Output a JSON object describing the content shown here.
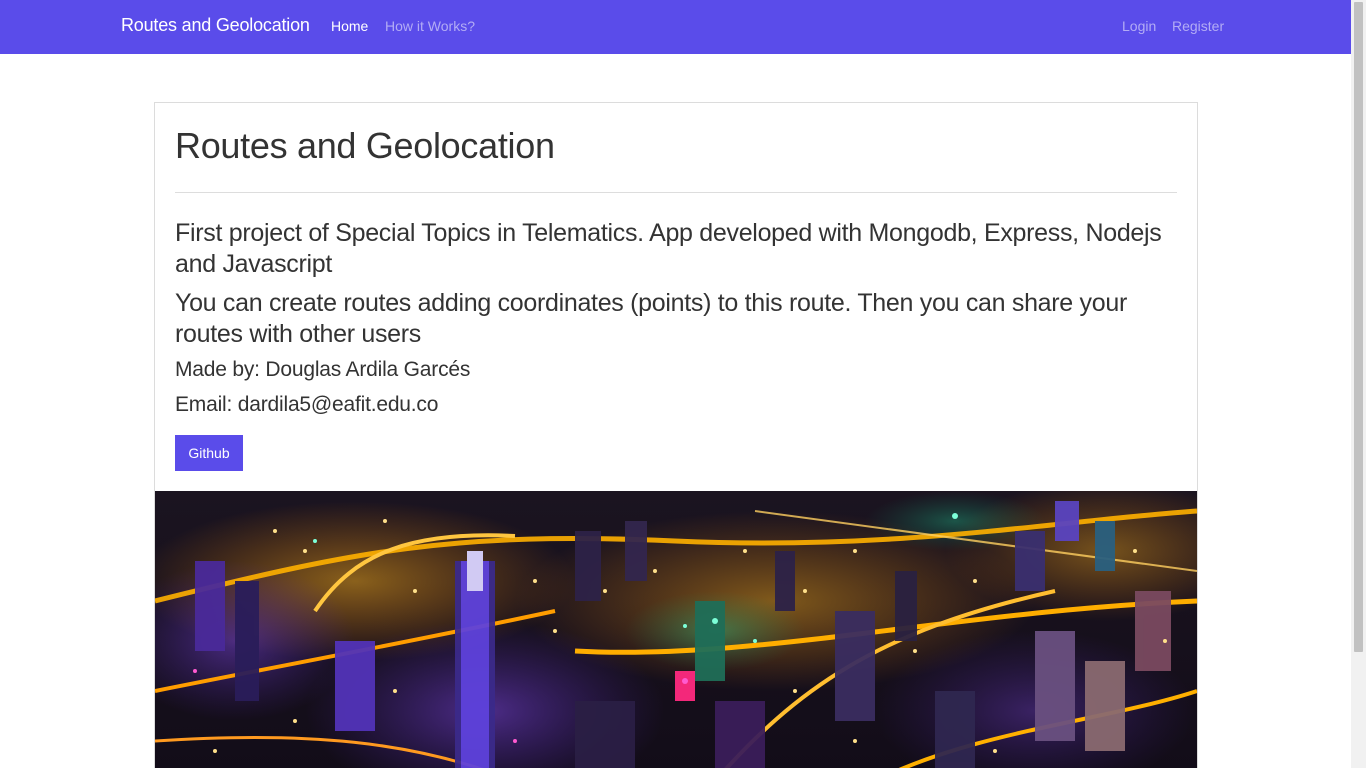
{
  "navbar": {
    "brand": "Routes and Geolocation",
    "links": [
      "Home",
      "How it Works?"
    ],
    "right_links": [
      "Login",
      "Register"
    ],
    "accent_color": "#5a4cea"
  },
  "main": {
    "title": "Routes and Geolocation",
    "description": "First project of Special Topics in Telematics. App developed with Mongodb, Express, Nodejs and Javascript",
    "details": "You can create routes adding coordinates (points) to this route. Then you can share your routes with other users",
    "author": "Made by: Douglas Ardila Garcés",
    "email": "Email: dardila5@eafit.edu.co",
    "github_label": "Github",
    "image": "night-city-aerial-photo"
  }
}
